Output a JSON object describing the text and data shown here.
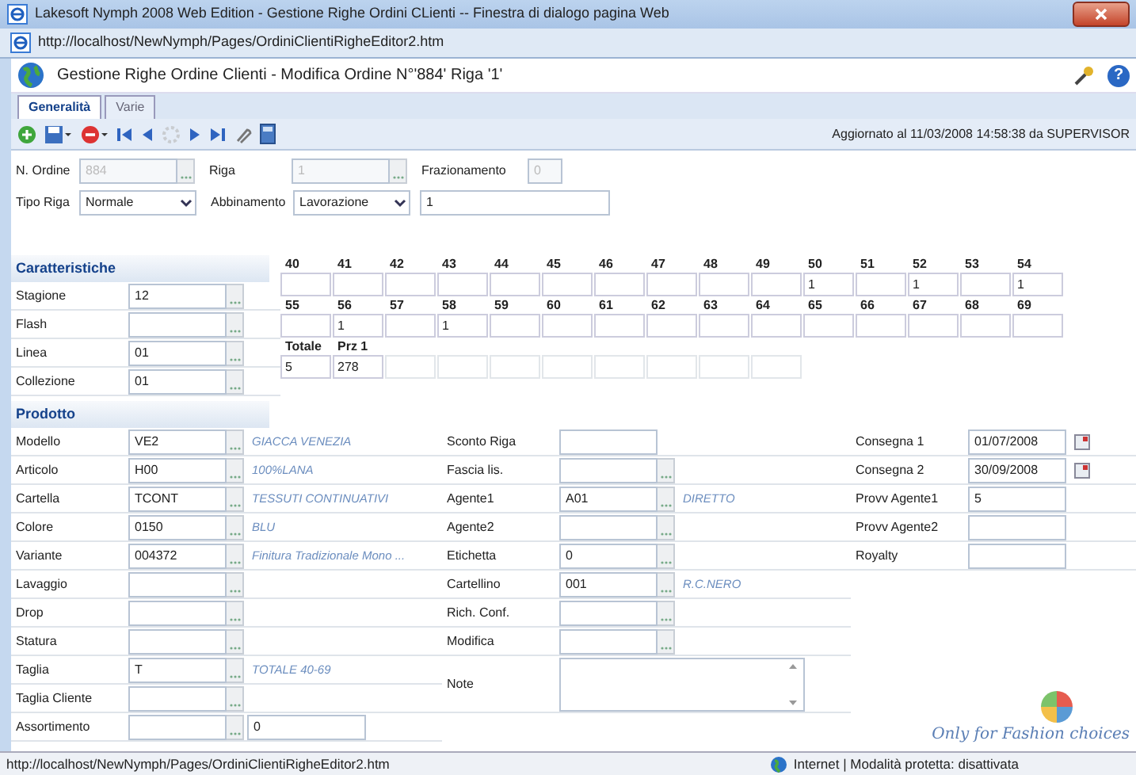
{
  "window": {
    "title": "Lakesoft Nymph 2008 Web Edition - Gestione Righe Ordini CLienti -- Finestra di dialogo pagina Web"
  },
  "address_bar": {
    "url": "http://localhost/NewNymph/Pages/OrdiniClientiRigheEditor2.htm"
  },
  "app_header": {
    "title": "Gestione Righe Ordine Clienti - Modifica Ordine N°'884' Riga '1'",
    "help_label": "?"
  },
  "tabs": [
    {
      "label": "Generalità",
      "selected": true
    },
    {
      "label": "Varie",
      "selected": false
    }
  ],
  "toolbar": {
    "status": "Aggiornato al 11/03/2008 14:58:38 da SUPERVISOR"
  },
  "order_rows": [
    [
      {
        "kind": "lookup",
        "label": "N. Ordine",
        "value": "884",
        "disabled": true
      },
      {
        "kind": "lookup",
        "label": "Riga",
        "value": "1",
        "disabled": true
      },
      {
        "kind": "text",
        "label": "Frazionamento",
        "value": "0",
        "disabled": true
      }
    ],
    [
      {
        "kind": "select",
        "label": "Tipo Riga",
        "value": "Normale",
        "disabled": false
      },
      {
        "kind": "select",
        "label": "Abbinamento",
        "value": "Lavorazione",
        "disabled": false
      },
      {
        "kind": "text",
        "value": "1",
        "disabled": false
      }
    ]
  ],
  "caratteristiche": {
    "title": "Caratteristiche",
    "fields": [
      {
        "label": "Stagione",
        "value": "12"
      },
      {
        "label": "Flash"
      },
      {
        "label": "Linea",
        "value": "01"
      },
      {
        "label": "Collezione",
        "value": "01"
      }
    ]
  },
  "sizes": [
    [
      {
        "size": "40"
      },
      {
        "size": "41"
      },
      {
        "size": "42"
      },
      {
        "size": "43"
      },
      {
        "size": "44"
      },
      {
        "size": "45"
      },
      {
        "size": "46"
      },
      {
        "size": "47"
      },
      {
        "size": "48"
      },
      {
        "size": "49"
      },
      {
        "size": "50",
        "value": "1"
      },
      {
        "size": "51"
      },
      {
        "size": "52",
        "value": "1"
      },
      {
        "size": "53"
      },
      {
        "size": "54",
        "value": "1"
      }
    ],
    [
      {
        "size": "55"
      },
      {
        "size": "56",
        "value": "1"
      },
      {
        "size": "57"
      },
      {
        "size": "58",
        "value": "1"
      },
      {
        "size": "59"
      },
      {
        "size": "60"
      },
      {
        "size": "61"
      },
      {
        "size": "62"
      },
      {
        "size": "63"
      },
      {
        "size": "64"
      },
      {
        "size": "65"
      },
      {
        "size": "66"
      },
      {
        "size": "67"
      },
      {
        "size": "68"
      },
      {
        "size": "69"
      }
    ]
  ],
  "totals": [
    {
      "label": "Totale",
      "value": "5"
    },
    {
      "label": "Prz 1",
      "value": "278"
    }
  ],
  "prodotto": {
    "title": "Prodotto",
    "columns": [
      [
        {
          "kind": "lookup",
          "label": "Modello",
          "value": "VE2",
          "description": "GIACCA VENEZIA"
        },
        {
          "kind": "lookup",
          "label": "Articolo",
          "value": "H00",
          "description": "100%LANA"
        },
        {
          "kind": "lookup",
          "label": "Cartella",
          "value": "TCONT",
          "description": "TESSUTI CONTINUATIVI"
        },
        {
          "kind": "lookup",
          "label": "Colore",
          "value": "0150",
          "description": "BLU"
        },
        {
          "kind": "lookup",
          "label": "Variante",
          "value": "004372",
          "description": "Finitura Tradizionale Mono ..."
        },
        {
          "kind": "lookup",
          "label": "Lavaggio"
        },
        {
          "kind": "lookup",
          "label": "Drop"
        },
        {
          "kind": "lookup",
          "label": "Statura"
        },
        {
          "kind": "lookup",
          "label": "Taglia",
          "value": "T",
          "description": "TOTALE 40-69"
        },
        {
          "kind": "lookup",
          "label": "Taglia Cliente"
        },
        {
          "kind": "lookup",
          "label": "Assortimento",
          "second_value": "0"
        }
      ],
      [
        {
          "kind": "text",
          "label": "Sconto Riga"
        },
        {
          "kind": "lookup",
          "label": "Fascia lis."
        },
        {
          "kind": "lookup",
          "label": "Agente1",
          "value": "A01",
          "description": "DIRETTO"
        },
        {
          "kind": "lookup",
          "label": "Agente2"
        },
        {
          "kind": "lookup",
          "label": "Etichetta",
          "value": "0"
        },
        {
          "kind": "lookup",
          "label": "Cartellino",
          "value": "001",
          "description": "R.C.NERO"
        },
        {
          "kind": "lookup",
          "label": "Rich. Conf."
        },
        {
          "kind": "lookup",
          "label": "Modifica"
        },
        {
          "kind": "textarea",
          "label": "Note"
        }
      ],
      [
        {
          "kind": "date",
          "label": "Consegna 1",
          "value": "01/07/2008"
        },
        {
          "kind": "date",
          "label": "Consegna 2",
          "value": "30/09/2008"
        },
        {
          "kind": "text",
          "label": "Provv Agente1",
          "value": "5"
        },
        {
          "kind": "text",
          "label": "Provv Agente2"
        },
        {
          "kind": "text",
          "label": "Royalty"
        }
      ]
    ]
  },
  "logo": {
    "tagline": "Only for Fashion choices"
  },
  "status_bar": {
    "url": "http://localhost/NewNymph/Pages/OrdiniClientiRigheEditor2.htm",
    "zone": "Internet | Modalità protetta: disattivata"
  }
}
